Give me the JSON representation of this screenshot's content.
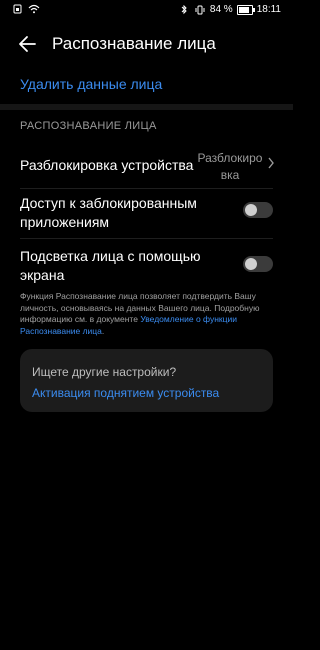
{
  "status_bar": {
    "left_icons": [
      "sim-icon",
      "wifi-icon"
    ],
    "right_icons": [
      "bluetooth-icon",
      "vibrate-icon"
    ],
    "battery_percent": "84 %",
    "battery_level": 0.84,
    "time": "18:11"
  },
  "header": {
    "title": "Распознавание лица",
    "back_icon": "arrow-left-icon"
  },
  "delete_face_data_label": "Удалить данные лица",
  "section": {
    "title": "РАСПОЗНАВАНИЕ ЛИЦА"
  },
  "rows": [
    {
      "title": "Разблокировка устройства",
      "value_line1": "Разблокиро",
      "value_line2": "вка",
      "icon": "chevron-right-icon"
    },
    {
      "title_line1": "Доступ к заблокированным",
      "title_line2": "приложениям",
      "toggle_on": false
    },
    {
      "title_line1": "Подсветка лица с помощью",
      "title_line2": "экрана",
      "toggle_on": false
    }
  ],
  "footnote": {
    "text": "Функция Распознавание лица позволяет подтвердить Вашу личность, основываясь на данных Вашего лица. Подробную информацию см. в документе ",
    "link": "Уведомление о функции Распознавание лица",
    "end": "."
  },
  "card": {
    "title": "Ищете другие настройки?",
    "link": "Активация поднятием устройства"
  },
  "colors": {
    "background": "#000000",
    "accent": "#3b8cf0",
    "secondary_text": "#9a9a9a",
    "card_bg": "#1c1c1c"
  }
}
